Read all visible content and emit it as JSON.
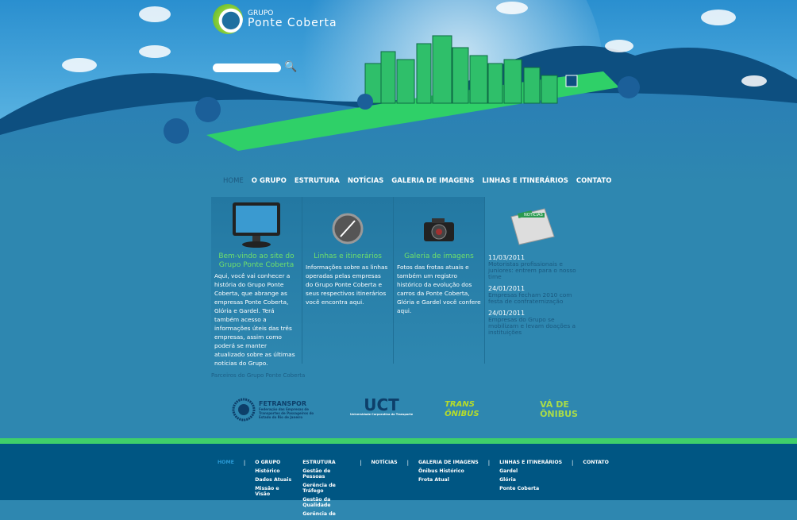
{
  "logo": {
    "line1": "GRUPO",
    "line2": "Ponte Coberta"
  },
  "search": {
    "placeholder": ""
  },
  "nav": [
    "HOME",
    "O GRUPO",
    "ESTRUTURA",
    "NOTÍCIAS",
    "GALERIA DE IMAGENS",
    "LINHAS E ITINERÁRIOS",
    "CONTATO"
  ],
  "columns": [
    {
      "title": "Bem-vindo ao site do Grupo Ponte Coberta",
      "text": "Aqui, você vai conhecer a história do Grupo Ponte Coberta, que abrange as empresas Ponte Coberta, Glória e Gardel. Terá também acesso a informações úteis das três empresas, assim como poderá se manter atualizado sobre as últimas notícias do Grupo."
    },
    {
      "title": "Linhas e itinerários",
      "text": "Informações sobre as linhas operadas pelas empresas do Grupo Ponte Coberta e seus respectivos itinerários você encontra aqui."
    },
    {
      "title": "Galeria de imagens",
      "text": "Fotos das frotas atuais e também um registro histórico da evolução dos carros da Ponte Coberta, Glória e Gardel você confere aqui."
    }
  ],
  "news": {
    "badge": "NOTÍCIAS",
    "items": [
      {
        "date": "11/03/2011",
        "title": "Motoristas profissionais e juniores: entrem para o nosso time"
      },
      {
        "date": "24/01/2011",
        "title": "Empresas fecham 2010 com festa de confraternização"
      },
      {
        "date": "24/01/2011",
        "title": "Empresas do Grupo se mobilizam e levam doações a instituições"
      }
    ]
  },
  "partners": {
    "label": "Parceiros do Grupo Ponte Coberta",
    "items": [
      "FETRANSPOR",
      "UCT",
      "TRANS ÔNIBUS",
      "VÁ DE ÔNIBUS"
    ],
    "fetranspor_sub": "Federação das Empresas de Transportes de Passageiros do Estado do Rio de Janeiro",
    "uct_sub": "Universidade Corporativa do Transporte"
  },
  "footer": [
    {
      "label": "HOME",
      "subs": []
    },
    {
      "label": "O GRUPO",
      "subs": [
        "Histórico",
        "Dados Atuais",
        "Missão e Visão"
      ]
    },
    {
      "label": "ESTRUTURA",
      "subs": [
        "Gestão de Pessoas",
        "Gerência de Tráfego",
        "Gestão da Qualidade",
        "Gerência de"
      ]
    },
    {
      "label": "NOTÍCIAS",
      "subs": []
    },
    {
      "label": "GALERIA DE IMAGENS",
      "subs": [
        "Ônibus Histórico",
        "Frota Atual"
      ]
    },
    {
      "label": "LINHAS E ITINERÁRIOS",
      "subs": [
        "Gardel",
        "Glória",
        "Ponte Coberta"
      ]
    },
    {
      "label": "CONTATO",
      "subs": []
    }
  ]
}
